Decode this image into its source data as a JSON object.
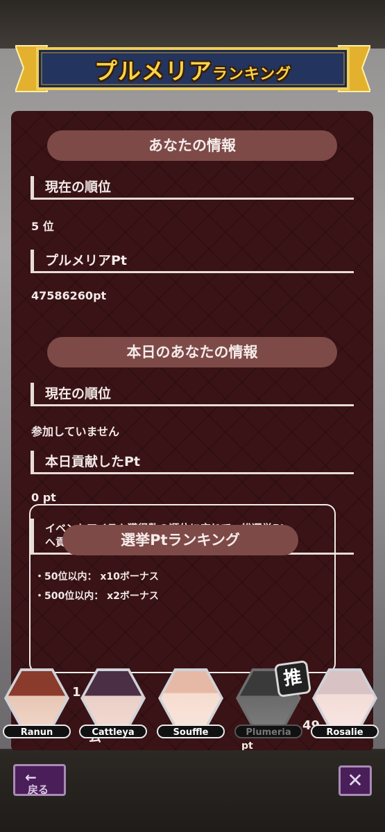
{
  "header": {
    "title_main": "プルメリア",
    "title_small": "ランキング"
  },
  "your_info": {
    "heading": "あなたの情報",
    "rank_label": "現在の順位",
    "rank_value": "5 位",
    "pt_label": "プルメリアPt",
    "pt_value": "47586260pt"
  },
  "today_info": {
    "heading": "本日のあなたの情報",
    "rank_label": "現在の順位",
    "rank_value": "参加していません",
    "pt_label": "本日貢献したPt",
    "pt_value": "0 pt",
    "note_line1": "イベントアイテム獲得数の順位に応じて、総選挙Pt",
    "note_line2": "へ貢献する倍率が決定します。",
    "bonus1": "・50位以内： x10ボーナス",
    "bonus2": "・500位以内： x2ボーナス"
  },
  "election": {
    "heading": "選挙Ptランキング",
    "partial_left": "1",
    "partial_mid": "ム",
    "partial_right": "49",
    "partial_pt": "pt"
  },
  "characters": [
    {
      "name": "Ranun",
      "hair_color": "#8a3b2c",
      "active": true
    },
    {
      "name": "Cattleya",
      "hair_color": "#4b2f45",
      "active": true
    },
    {
      "name": "Souffle",
      "hair_color": "#e6b9a6",
      "active": true
    },
    {
      "name": "Plumeria",
      "hair_color": "#4b4b4b",
      "active": false
    },
    {
      "name": "Rosalie",
      "hair_color": "#d9c2c4",
      "active": true
    }
  ],
  "oshi_badge": "推",
  "nav": {
    "back_label": "戻る",
    "back_arrow": "←",
    "close_label": "✕"
  }
}
